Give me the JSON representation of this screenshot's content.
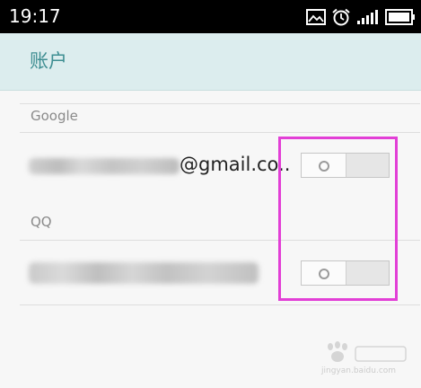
{
  "status_bar": {
    "time": "19:17",
    "icons": [
      "image-icon",
      "alarm-icon",
      "signal-icon",
      "battery-icon"
    ]
  },
  "action_bar": {
    "title": "账户"
  },
  "sections": [
    {
      "header": "Google",
      "accounts": [
        {
          "visible_text": "@gmail.co..",
          "sync_enabled": false
        }
      ]
    },
    {
      "header": "QQ",
      "accounts": [
        {
          "visible_text": "",
          "sync_enabled": false
        }
      ]
    }
  ],
  "colors": {
    "status_bar_bg": "#000000",
    "action_bar_bg": "#dcedee",
    "title_color": "#3e8e92",
    "highlight": "#e23fd6"
  },
  "watermark": {
    "url": "jingyan.baidu.com"
  }
}
